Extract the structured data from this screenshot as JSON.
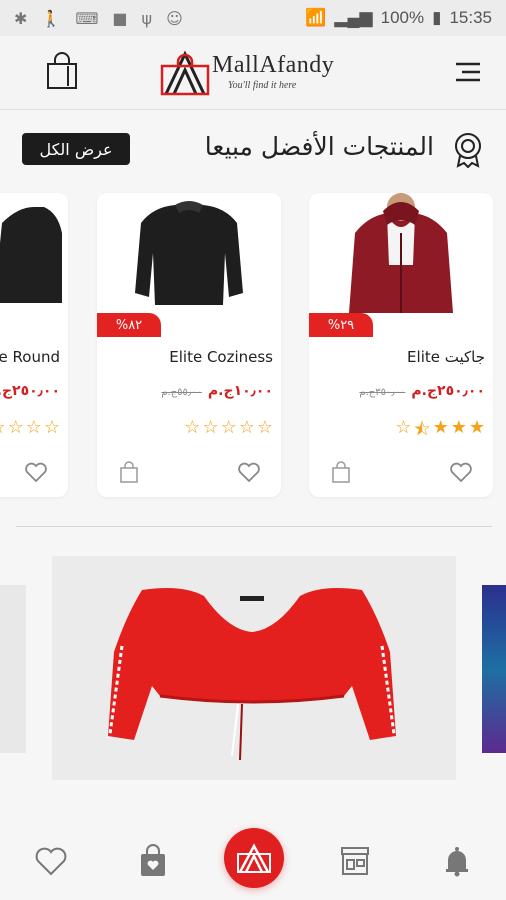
{
  "status_bar": {
    "battery": "100%",
    "time": "15:35"
  },
  "app_bar": {
    "logo_text": "MallAfandy",
    "logo_tagline": "You'll find it here"
  },
  "section": {
    "title": "المنتجات الأفضل مبيعا",
    "view_all": "عرض الكل"
  },
  "products": [
    {
      "name": "Elite جاكيت",
      "price": "٢٥٠٫٠٠ج.م",
      "old_price": "٣٥٠٫٠٠ج.م",
      "discount": "%٢٩",
      "stars": [
        1,
        1,
        1,
        0.5,
        0
      ]
    },
    {
      "name": "Elite Coziness",
      "price": "١٠٫٠٠ج.م",
      "old_price": "٥٥٫٠٠ج.م",
      "discount": "%٨٢",
      "stars": [
        0,
        0,
        0,
        0,
        0
      ]
    },
    {
      "name": "e Round",
      "price": "٢٥٠٫٠٠ج.م",
      "old_price": "",
      "discount": "",
      "stars": [
        0,
        0,
        0,
        0,
        0
      ]
    }
  ],
  "colors": {
    "accent": "#e02020",
    "dark": "#1c1c1c",
    "star": "#f4a316"
  }
}
